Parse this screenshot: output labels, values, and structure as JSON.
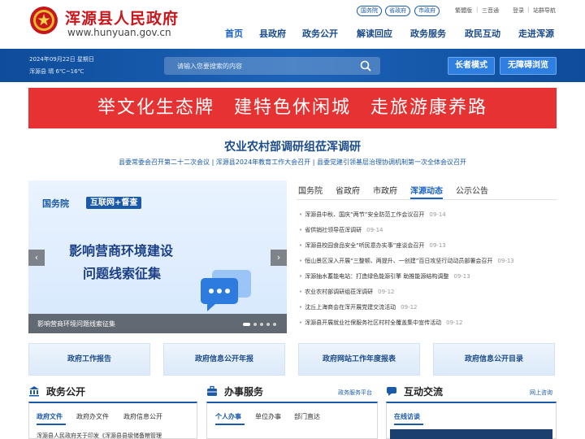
{
  "header": {
    "site_title": "浑源县人民政府",
    "site_domain": "www.hunyuan.gov.cn",
    "top_links": [
      "国务院",
      "省政府",
      "市政府"
    ],
    "utility": [
      "繁體版",
      "三音通",
      "登录",
      "站群导航"
    ],
    "nav": [
      "首页",
      "县政府",
      "政务公开",
      "解读回应",
      "政务服务",
      "政民互动",
      "走进浑源"
    ]
  },
  "info_bar": {
    "date": "2024年09月22日 星期日",
    "weather": "浑源县 晴 6℃~16℃",
    "search_placeholder": "请输入您要搜索的内容",
    "elder_mode": "长者模式",
    "accessible": "无障碍浏览"
  },
  "banner": {
    "slogan": "举文化生态牌　建特色休闲城　走旅游康养路"
  },
  "headline": {
    "title": "农业农村部调研组莅浑调研",
    "subline": "县委常委会召开第二十二次会议 | 浑源县2024年教育工作大会召开 | 县委党建引领基层治理协调机制第一次全体会议召开"
  },
  "carousel": {
    "tag1": "国务院",
    "tag2": "互联网+督查",
    "title_line1": "影响营商环境建设",
    "title_line2": "问题线索征集",
    "caption": "影响营商环境问题线索征集",
    "prev": "‹",
    "next": "›"
  },
  "news": {
    "tabs": [
      "国务院",
      "省政府",
      "市政府",
      "浑源动态",
      "公示公告"
    ],
    "active_tab": "浑源动态",
    "items": [
      {
        "title": "浑源县中秋、国庆“两节”安全防范工作会议召开",
        "date": "09-14"
      },
      {
        "title": "省供销社领导莅浑调研",
        "date": "09-14"
      },
      {
        "title": "浑源县校园食品安全“听民意办实事”座谈会召开",
        "date": "09-13"
      },
      {
        "title": "恒山景区深入开展“三整顿、两提升、一创建”百日攻坚行动动员部署会召开",
        "date": "09-13"
      },
      {
        "title": "浑源抽水蓄能电站：打造绿色能源引擎 助推能源结构调整",
        "date": "09-13"
      },
      {
        "title": "农业农村部调研组莅浑调研",
        "date": "09-12"
      },
      {
        "title": "沈丘上海商会在浑开展党建交流活动",
        "date": "09-12"
      },
      {
        "title": "浑源县开展就业社保服务社区村村全覆盖集中宣传活动",
        "date": "09-12"
      }
    ]
  },
  "reports": [
    "政府工作报告",
    "政府信息公开年报",
    "政府网站工作年度报表",
    "政府信息公开目录"
  ],
  "sections": {
    "gov_open": {
      "title": "政务公开",
      "tabs": [
        "政府文件",
        "政府办文件",
        "政府信息公开"
      ],
      "peek": "浑源县人民政府关于印发《浑源县县级储备粮管理"
    },
    "services": {
      "title": "办事服务",
      "more": "政务服务平台",
      "tabs": [
        "个人办事",
        "单位办事",
        "部门直达"
      ]
    },
    "interact": {
      "title": "互动交流",
      "more": "网上咨询",
      "tabs": [
        "在线访谈"
      ]
    }
  },
  "colors": {
    "brand_blue": "#1a5aa8",
    "nav_blue": "#1b4b8a",
    "banner_red": "#e63232",
    "title_red": "#c8161d"
  }
}
